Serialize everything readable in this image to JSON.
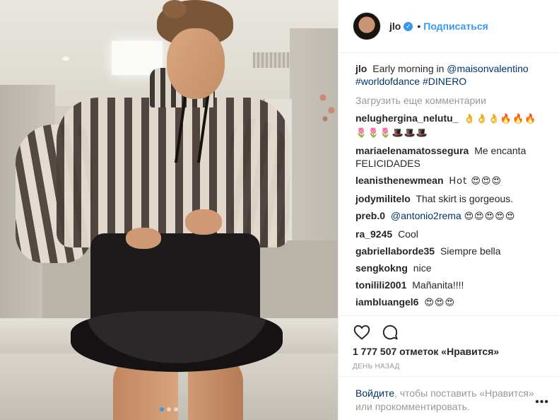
{
  "post": {
    "username": "jlo",
    "verified_icon": "verified-badge-icon",
    "follow_label": "Подписаться",
    "separator": "•"
  },
  "caption": {
    "username": "jlo",
    "text_before": "Early morning in",
    "mention": "@maisonvalentino",
    "hashtag1": "#worldofdance",
    "hashtag2": "#DINERO"
  },
  "load_more_label": "Загрузить еще комментарии",
  "comments": [
    {
      "user": "nelughergina_nelutu_",
      "text": "👌👌👌🔥🔥🔥🌷🌷🌷🎩🎩🎩"
    },
    {
      "user": "mariaelenamatossegura",
      "text": "Me encanta FELICIDADES"
    },
    {
      "user": "leanisthenewmean",
      "text": "Hot 😍😍😍"
    },
    {
      "user": "jodymilitelo",
      "text": "That skirt is gorgeous."
    },
    {
      "user": "preb.0",
      "mention": "@antonio2rema",
      "text": "😍😍😍😍😍"
    },
    {
      "user": "ra_9245",
      "text": "Cool"
    },
    {
      "user": "gabriellaborde35",
      "text": "Siempre bella"
    },
    {
      "user": "sengkokng",
      "text": "nice"
    },
    {
      "user": "tonilili2001",
      "text": "Mañanita!!!!"
    },
    {
      "user": "iambluangel6",
      "text": "😍😍😍"
    }
  ],
  "actions": {
    "like_icon": "heart-icon",
    "comment_icon": "comment-icon",
    "likes_text": "1 777 507 отметок «Нравится»",
    "time_text": "ДЕНЬ НАЗАД"
  },
  "login": {
    "link_text": "Войдите",
    "rest_text": ", чтобы поставить «Нравится» или прокомментировать."
  },
  "more_label": "•••",
  "carousel": {
    "count": 3,
    "active": 1
  },
  "colors": {
    "link": "#3897f0",
    "text": "#262626",
    "muted": "#999999"
  }
}
